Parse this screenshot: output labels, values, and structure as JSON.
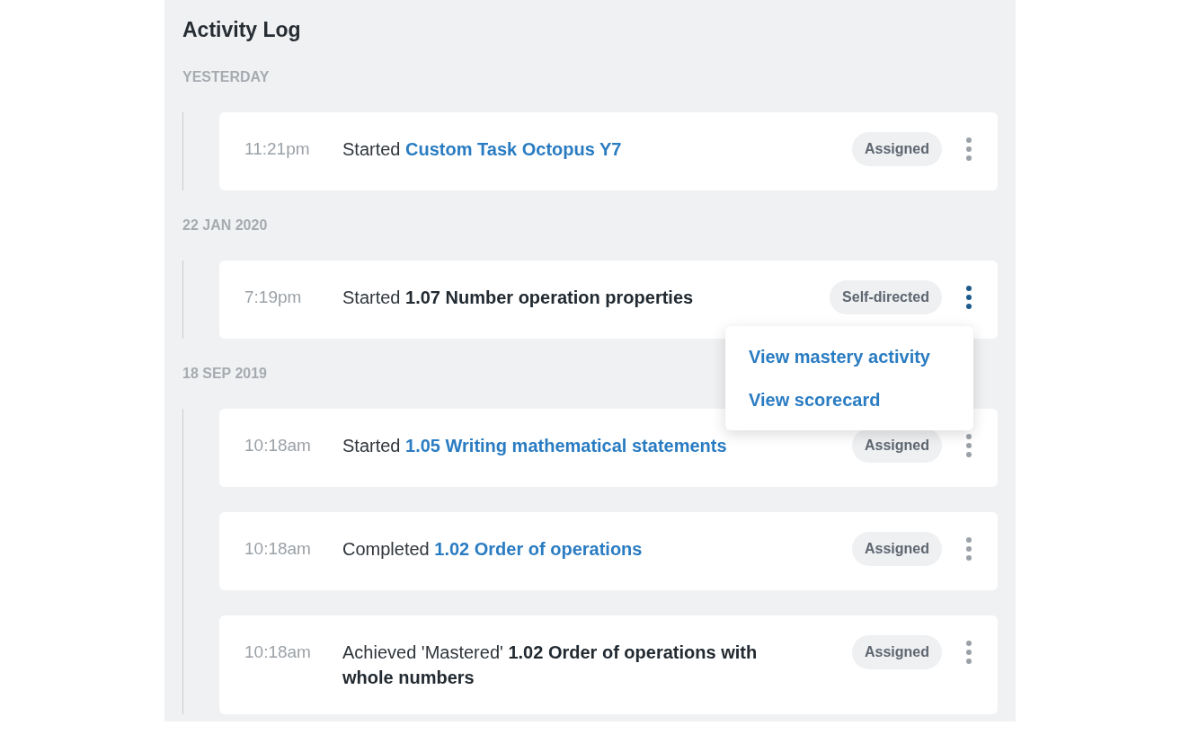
{
  "title": "Activity Log",
  "sections": [
    {
      "label": "YESTERDAY",
      "entries": [
        {
          "time": "11:21pm",
          "verb": "Started",
          "target": "Custom Task Octopus Y7",
          "linked": true,
          "badge": "Assigned",
          "menu_open": false
        }
      ]
    },
    {
      "label": "22 JAN 2020",
      "entries": [
        {
          "time": "7:19pm",
          "verb": "Started",
          "target": "1.07 Number operation properties",
          "linked": false,
          "badge": "Self-directed",
          "menu_open": true,
          "menu": [
            "View mastery activity",
            "View scorecard"
          ]
        }
      ]
    },
    {
      "label": "18 SEP 2019",
      "entries": [
        {
          "time": "10:18am",
          "verb": "Started",
          "target": "1.05 Writing mathematical statements",
          "linked": true,
          "badge": "Assigned",
          "menu_open": false
        },
        {
          "time": "10:18am",
          "verb": "Completed",
          "target": "1.02 Order of operations",
          "linked": true,
          "badge": "Assigned",
          "menu_open": false
        },
        {
          "time": "10:18am",
          "verb": "Achieved 'Mastered'",
          "target": "1.02 Order of operations with whole numbers",
          "linked": false,
          "badge": "Assigned",
          "menu_open": false
        }
      ]
    }
  ]
}
